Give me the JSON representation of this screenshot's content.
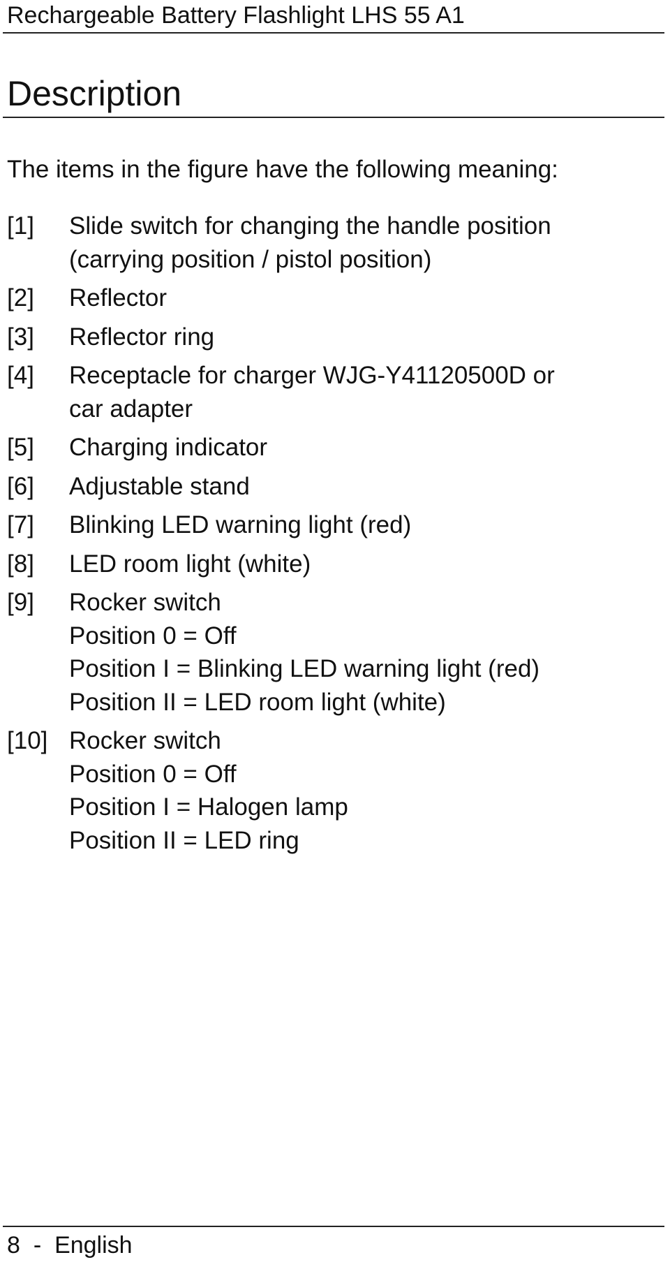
{
  "header": {
    "title": "Rechargeable Battery Flashlight LHS 55 A1"
  },
  "section": {
    "heading": "Description"
  },
  "intro": "The items in the figure have the following meaning:",
  "items": [
    {
      "num": "[1]",
      "lines": [
        "Slide switch for changing the handle position",
        "(carrying position / pistol position)"
      ]
    },
    {
      "num": "[2]",
      "lines": [
        "Reflector"
      ]
    },
    {
      "num": "[3]",
      "lines": [
        "Reflector ring"
      ]
    },
    {
      "num": "[4]",
      "lines": [
        "Receptacle for charger WJG-Y41120500D or",
        "car adapter"
      ]
    },
    {
      "num": "[5]",
      "lines": [
        "Charging indicator"
      ]
    },
    {
      "num": "[6]",
      "lines": [
        "Adjustable stand"
      ]
    },
    {
      "num": "[7]",
      "lines": [
        "Blinking LED warning light (red)"
      ]
    },
    {
      "num": "[8]",
      "lines": [
        "LED room light (white)"
      ]
    },
    {
      "num": "[9]",
      "lines": [
        "Rocker switch",
        "Position 0 = Off",
        "Position I = Blinking LED warning light (red)",
        "Position II = LED room light (white)"
      ]
    },
    {
      "num": "[10]",
      "lines": [
        "Rocker switch",
        "Position 0 = Off",
        "Position I = Halogen lamp",
        "Position II = LED ring"
      ]
    }
  ],
  "footer": {
    "page": "8",
    "separator": "-",
    "language": "English"
  }
}
